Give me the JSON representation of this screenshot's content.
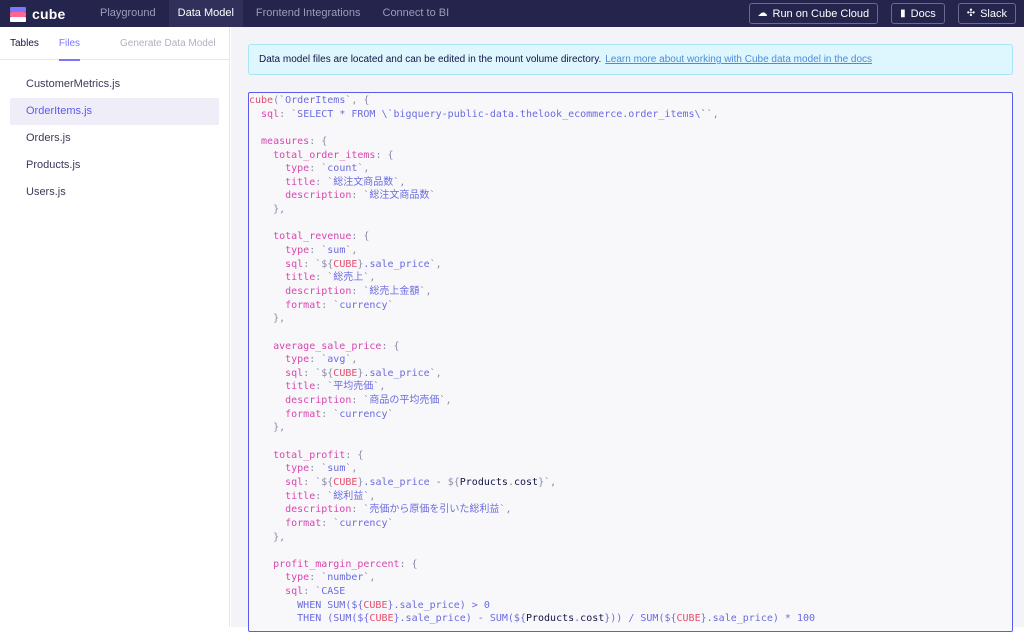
{
  "app": {
    "logo_text": "cube"
  },
  "nav": {
    "tabs": [
      {
        "label": "Playground",
        "active": false
      },
      {
        "label": "Data Model",
        "active": true
      },
      {
        "label": "Frontend Integrations",
        "active": false
      },
      {
        "label": "Connect to BI",
        "active": false
      }
    ],
    "buttons": [
      {
        "label": "Run on Cube Cloud",
        "icon": "cloud-icon"
      },
      {
        "label": "Docs",
        "icon": "document-icon"
      },
      {
        "label": "Slack",
        "icon": "slack-icon"
      }
    ]
  },
  "sidebar": {
    "tabs": [
      {
        "label": "Tables",
        "active": false
      },
      {
        "label": "Files",
        "active": true
      },
      {
        "label": "Generate Data Model",
        "active": false
      }
    ],
    "files": [
      {
        "label": "CustomerMetrics.js",
        "active": false
      },
      {
        "label": "OrderItems.js",
        "active": true
      },
      {
        "label": "Orders.js",
        "active": false
      },
      {
        "label": "Products.js",
        "active": false
      },
      {
        "label": "Users.js",
        "active": false
      }
    ]
  },
  "info": {
    "text": "Data model files are located and can be edited in the mount volume directory.",
    "link": "Learn more about working with Cube data model in the docs"
  },
  "editor": {
    "lines": [
      [
        [
          "fn",
          "cube"
        ],
        [
          "p",
          "(`"
        ],
        [
          "str",
          "OrderItems"
        ],
        [
          "p",
          "`, {"
        ]
      ],
      [
        [
          "key",
          "  sql"
        ],
        [
          "p",
          ": `"
        ],
        [
          "str",
          "SELECT * FROM \\`bigquery-public-data.thelook_ecommerce.order_items\\`"
        ],
        [
          "p",
          "`,"
        ]
      ],
      [],
      [
        [
          "key",
          "  measures"
        ],
        [
          "p",
          ": {"
        ]
      ],
      [
        [
          "key",
          "    total_order_items"
        ],
        [
          "p",
          ": {"
        ]
      ],
      [
        [
          "key",
          "      type"
        ],
        [
          "p",
          ": `"
        ],
        [
          "str",
          "count"
        ],
        [
          "p",
          "`,"
        ]
      ],
      [
        [
          "key",
          "      title"
        ],
        [
          "p",
          ": `"
        ],
        [
          "str",
          "総注文商品数"
        ],
        [
          "p",
          "`,"
        ]
      ],
      [
        [
          "key",
          "      description"
        ],
        [
          "p",
          ": `"
        ],
        [
          "str",
          "総注文商品数"
        ],
        [
          "p",
          "`"
        ]
      ],
      [
        [
          "p",
          "    },"
        ]
      ],
      [],
      [
        [
          "key",
          "    total_revenue"
        ],
        [
          "p",
          ": {"
        ]
      ],
      [
        [
          "key",
          "      type"
        ],
        [
          "p",
          ": `"
        ],
        [
          "str",
          "sum"
        ],
        [
          "p",
          "`,"
        ]
      ],
      [
        [
          "key",
          "      sql"
        ],
        [
          "p",
          ": `${"
        ],
        [
          "fn",
          "CUBE"
        ],
        [
          "p",
          "}"
        ],
        [
          "str",
          ".sale_price"
        ],
        [
          "p",
          "`,"
        ]
      ],
      [
        [
          "key",
          "      title"
        ],
        [
          "p",
          ": `"
        ],
        [
          "str",
          "総売上"
        ],
        [
          "p",
          "`,"
        ]
      ],
      [
        [
          "key",
          "      description"
        ],
        [
          "p",
          ": `"
        ],
        [
          "str",
          "総売上金額"
        ],
        [
          "p",
          "`,"
        ]
      ],
      [
        [
          "key",
          "      format"
        ],
        [
          "p",
          ": `"
        ],
        [
          "str",
          "currency"
        ],
        [
          "p",
          "`"
        ]
      ],
      [
        [
          "p",
          "    },"
        ]
      ],
      [],
      [
        [
          "key",
          "    average_sale_price"
        ],
        [
          "p",
          ": {"
        ]
      ],
      [
        [
          "key",
          "      type"
        ],
        [
          "p",
          ": `"
        ],
        [
          "str",
          "avg"
        ],
        [
          "p",
          "`,"
        ]
      ],
      [
        [
          "key",
          "      sql"
        ],
        [
          "p",
          ": `${"
        ],
        [
          "fn",
          "CUBE"
        ],
        [
          "p",
          "}"
        ],
        [
          "str",
          ".sale_price"
        ],
        [
          "p",
          "`,"
        ]
      ],
      [
        [
          "key",
          "      title"
        ],
        [
          "p",
          ": `"
        ],
        [
          "str",
          "平均売価"
        ],
        [
          "p",
          "`,"
        ]
      ],
      [
        [
          "key",
          "      description"
        ],
        [
          "p",
          ": `"
        ],
        [
          "str",
          "商品の平均売価"
        ],
        [
          "p",
          "`,"
        ]
      ],
      [
        [
          "key",
          "      format"
        ],
        [
          "p",
          ": `"
        ],
        [
          "str",
          "currency"
        ],
        [
          "p",
          "`"
        ]
      ],
      [
        [
          "p",
          "    },"
        ]
      ],
      [],
      [
        [
          "key",
          "    total_profit"
        ],
        [
          "p",
          ": {"
        ]
      ],
      [
        [
          "key",
          "      type"
        ],
        [
          "p",
          ": `"
        ],
        [
          "str",
          "sum"
        ],
        [
          "p",
          "`,"
        ]
      ],
      [
        [
          "key",
          "      sql"
        ],
        [
          "p",
          ": `${"
        ],
        [
          "fn",
          "CUBE"
        ],
        [
          "p",
          "}"
        ],
        [
          "str",
          ".sale_price - "
        ],
        [
          "p",
          "${"
        ],
        [
          "txt",
          "Products"
        ],
        [
          "p",
          "."
        ],
        [
          "txt",
          "cost"
        ],
        [
          "p",
          "}`,"
        ]
      ],
      [
        [
          "key",
          "      title"
        ],
        [
          "p",
          ": `"
        ],
        [
          "str",
          "総利益"
        ],
        [
          "p",
          "`,"
        ]
      ],
      [
        [
          "key",
          "      description"
        ],
        [
          "p",
          ": `"
        ],
        [
          "str",
          "売価から原価を引いた総利益"
        ],
        [
          "p",
          "`,"
        ]
      ],
      [
        [
          "key",
          "      format"
        ],
        [
          "p",
          ": `"
        ],
        [
          "str",
          "currency"
        ],
        [
          "p",
          "`"
        ]
      ],
      [
        [
          "p",
          "    },"
        ]
      ],
      [],
      [
        [
          "key",
          "    profit_margin_percent"
        ],
        [
          "p",
          ": {"
        ]
      ],
      [
        [
          "key",
          "      type"
        ],
        [
          "p",
          ": `"
        ],
        [
          "str",
          "number"
        ],
        [
          "p",
          "`,"
        ]
      ],
      [
        [
          "key",
          "      sql"
        ],
        [
          "p",
          ": `"
        ],
        [
          "str",
          "CASE"
        ]
      ],
      [
        [
          "str",
          "        WHEN SUM(${"
        ],
        [
          "fn",
          "CUBE"
        ],
        [
          "str",
          "}.sale_price) > 0"
        ]
      ],
      [
        [
          "str",
          "        THEN (SUM(${"
        ],
        [
          "fn",
          "CUBE"
        ],
        [
          "str",
          "}.sale_price) - SUM(${"
        ],
        [
          "txt",
          "Products"
        ],
        [
          "str",
          "."
        ],
        [
          "txt",
          "cost"
        ],
        [
          "str",
          "})) / SUM(${"
        ],
        [
          "fn",
          "CUBE"
        ],
        [
          "str",
          "}.sale_price) * 100"
        ]
      ]
    ]
  },
  "colors": {
    "nav_bg": "#24244c",
    "accent": "#7a77ff",
    "info_bg": "#def6fd"
  }
}
